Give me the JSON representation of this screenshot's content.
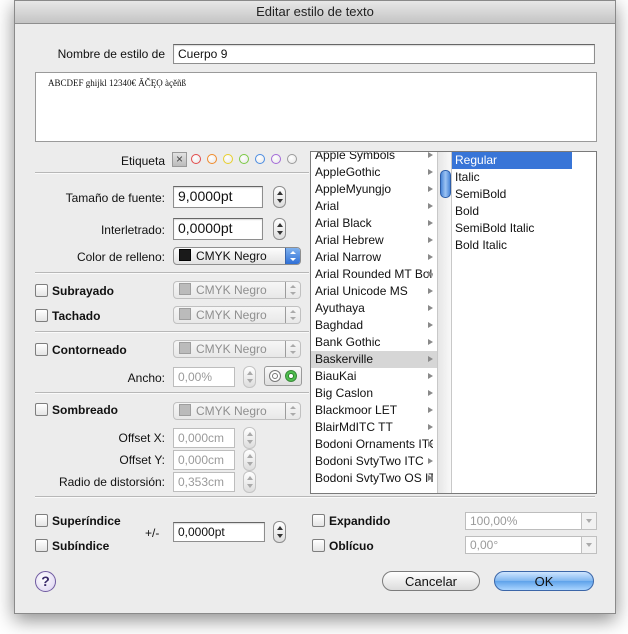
{
  "window": {
    "title": "Editar estilo de texto"
  },
  "style_name": {
    "label": "Nombre de estilo de",
    "value": "Cuerpo 9"
  },
  "preview": {
    "text": "ABCDEF ghijkl 12340€ ĀČĘỌ àçěñß"
  },
  "etiqueta": {
    "label": "Etiqueta",
    "clear": "×",
    "colors": [
      "#e24a4a",
      "#f08a2a",
      "#e8cf2a",
      "#7ac943",
      "#4a8ce2",
      "#a36ad8",
      "#9a9a9a"
    ]
  },
  "font_size": {
    "label": "Tamaño de fuente:",
    "value": "9,0000pt"
  },
  "leading": {
    "label": "Interletrado:",
    "value": "0,0000pt"
  },
  "fill": {
    "label": "Color de relleno:",
    "value": "CMYK Negro"
  },
  "underline": {
    "label": "Subrayado",
    "color": "CMYK Negro"
  },
  "strike": {
    "label": "Tachado",
    "color": "CMYK Negro"
  },
  "outline": {
    "label": "Contorneado",
    "color": "CMYK Negro",
    "width_label": "Ancho:",
    "width_value": "0,00%"
  },
  "shadow": {
    "label": "Sombreado",
    "color": "CMYK Negro",
    "offset_x_label": "Offset X:",
    "offset_x": "0,000cm",
    "offset_y_label": "Offset Y:",
    "offset_y": "0,000cm",
    "blur_label": "Radio de distorsión:",
    "blur": "0,353cm"
  },
  "fonts": [
    "Apple Symbols",
    "AppleGothic",
    "AppleMyungjo",
    "Arial",
    "Arial Black",
    "Arial Hebrew",
    "Arial Narrow",
    "Arial Rounded MT Bold",
    "Arial Unicode MS",
    "Ayuthaya",
    "Baghdad",
    "Bank Gothic",
    "Baskerville",
    "BiauKai",
    "Big Caslon",
    "Blackmoor LET",
    "BlairMdITC TT",
    "Bodoni Ornaments ITC",
    "Bodoni SvtyTwo ITC",
    "Bodoni SvtyTwo OS ITC"
  ],
  "selected_font": "Baskerville",
  "styles": [
    "Regular",
    "Italic",
    "SemiBold",
    "Bold",
    "SemiBold Italic",
    "Bold Italic"
  ],
  "selected_style": "Regular",
  "superscript": {
    "label": "Superíndice"
  },
  "subscript": {
    "label": "Subíndice"
  },
  "baseline": {
    "label": "+/-",
    "value": "0,0000pt"
  },
  "expanded": {
    "label": "Expandido",
    "value": "100,00%"
  },
  "oblique": {
    "label": "Oblícuo",
    "value": "0,00°"
  },
  "help": {
    "label": "?"
  },
  "buttons": {
    "cancel": "Cancelar",
    "ok": "OK"
  }
}
